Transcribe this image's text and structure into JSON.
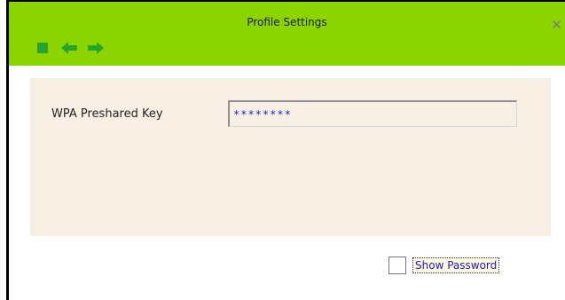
{
  "window": {
    "title": "Profile Settings",
    "close_glyph": "✕"
  },
  "toolbar": {
    "buttons": [
      {
        "icon": "stop-icon"
      },
      {
        "icon": "arrow-left-icon"
      },
      {
        "icon": "arrow-right-icon"
      }
    ]
  },
  "form": {
    "wpa_key_label": "WPA Preshared Key",
    "wpa_key_value": "********",
    "show_password_label": "Show Password",
    "show_password_checked": false
  },
  "colors": {
    "title_bar": "#8cd400",
    "panel_background": "#f7efe4",
    "icon_fill": "#27a52a",
    "input_text": "#1b1bd6"
  }
}
